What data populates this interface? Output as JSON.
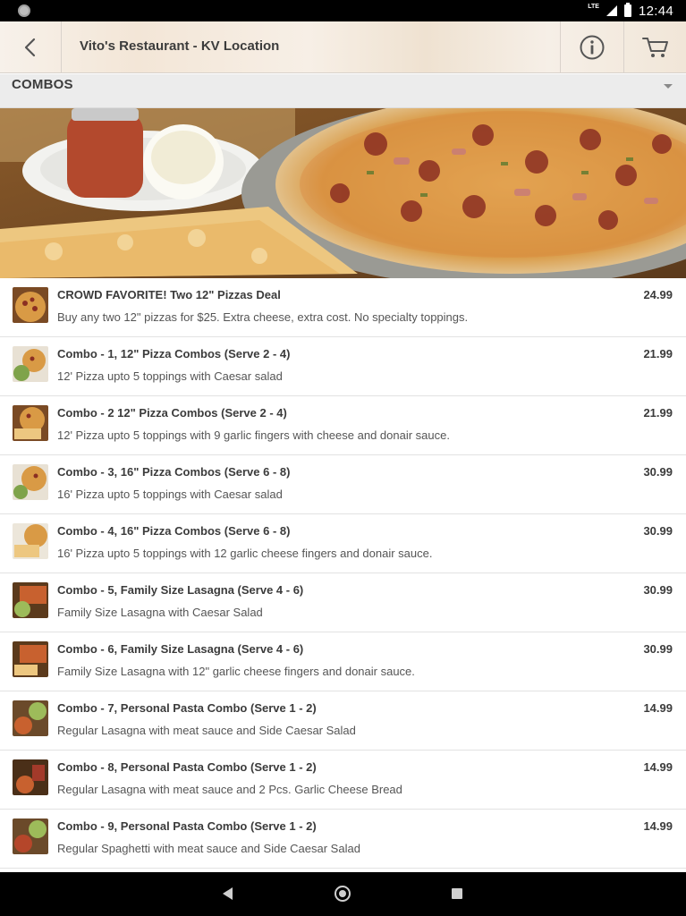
{
  "status_bar": {
    "time": "12:44",
    "network": "LTE"
  },
  "header": {
    "title": "Vito's Restaurant - KV Location"
  },
  "category": {
    "selected": "COMBOS"
  },
  "icons": {
    "back": "arrow-left-icon",
    "info": "info-icon",
    "cart": "cart-icon"
  },
  "colors": {
    "header_text": "#3c3c3c",
    "category_bg": "#ececec"
  },
  "menu_items": [
    {
      "title": "CROWD FAVORITE! Two 12\" Pizzas Deal",
      "description": "Buy any two 12\" pizzas for $25. Extra cheese, extra cost. No specialty toppings.",
      "price": "24.99"
    },
    {
      "title": "Combo - 1, 12\" Pizza Combos (Serve 2 - 4)",
      "description": "12' Pizza upto 5 toppings with Caesar salad",
      "price": "21.99"
    },
    {
      "title": "Combo - 2 12\" Pizza Combos (Serve 2 - 4)",
      "description": "12' Pizza upto 5 toppings with 9 garlic fingers with cheese and donair sauce.",
      "price": "21.99"
    },
    {
      "title": "Combo - 3, 16\" Pizza Combos (Serve 6 - 8)",
      "description": "16' Pizza upto 5 toppings with Caesar salad",
      "price": "30.99"
    },
    {
      "title": "Combo - 4, 16\" Pizza Combos (Serve 6 - 8)",
      "description": "16' Pizza upto 5 toppings with 12 garlic cheese fingers and donair sauce.",
      "price": "30.99"
    },
    {
      "title": "Combo - 5, Family Size Lasagna (Serve 4 - 6)",
      "description": "Family Size Lasagna with Caesar Salad",
      "price": "30.99"
    },
    {
      "title": "Combo - 6, Family Size Lasagna (Serve 4 - 6)",
      "description": "Family Size Lasagna with 12\" garlic cheese fingers and donair sauce.",
      "price": "30.99"
    },
    {
      "title": "Combo - 7, Personal Pasta Combo (Serve 1 - 2)",
      "description": "Regular Lasagna with meat sauce and Side Caesar Salad",
      "price": "14.99"
    },
    {
      "title": "Combo - 8, Personal Pasta Combo (Serve 1 - 2)",
      "description": "Regular Lasagna with meat sauce and 2 Pcs. Garlic Cheese Bread",
      "price": "14.99"
    },
    {
      "title": "Combo - 9, Personal Pasta Combo (Serve 1 - 2)",
      "description": "Regular Spaghetti with meat sauce and Side Caesar Salad",
      "price": "14.99"
    }
  ]
}
